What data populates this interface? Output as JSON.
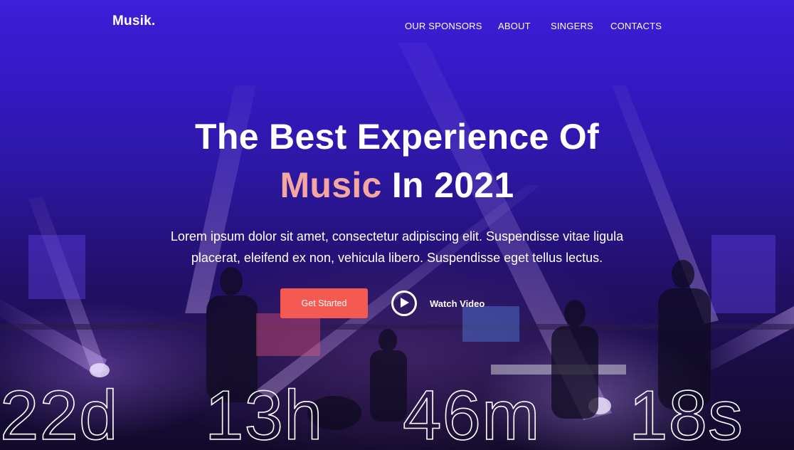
{
  "brand": {
    "logo_text": "Musik."
  },
  "nav": {
    "items": [
      {
        "label": "OUR SPONSORS"
      },
      {
        "label": "ABOUT"
      },
      {
        "label": "SINGERS"
      },
      {
        "label": "CONTACTS"
      }
    ]
  },
  "hero": {
    "headline_line1": "The Best Experience Of",
    "headline_accent": "Music",
    "headline_line2_rest": " In 2021",
    "subtitle_line1": "Lorem ipsum dolor sit amet, consectetur adipiscing elit. Suspendisse vitae ligula",
    "subtitle_line2": "placerat, eleifend ex non, vehicula libero. Suspendisse eget tellus lectus.",
    "cta_label": "Get Started",
    "video_label": "Watch Video",
    "video_icon": "play-icon",
    "background_photo": "concert-stage-icon"
  },
  "countdown": {
    "days": "22d",
    "hours": "13h",
    "minutes": "46m",
    "seconds": "18s"
  },
  "colors": {
    "background_top": "#3e1ed9",
    "accent_text": "#f5a79f",
    "cta_button": "#f55a52",
    "text": "#ffffff"
  }
}
